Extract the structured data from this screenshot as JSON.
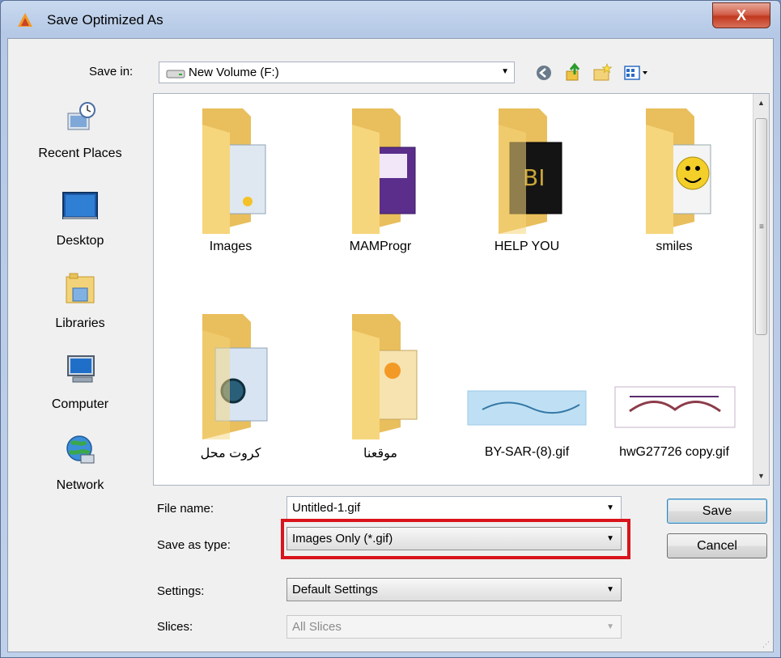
{
  "window": {
    "title": "Save Optimized As",
    "close_label": "X"
  },
  "toolbar": {
    "save_in_label": "Save in:",
    "save_in_value": "New Volume (F:)"
  },
  "places": [
    {
      "label": "Recent Places",
      "icon": "recent-places-icon"
    },
    {
      "label": "Desktop",
      "icon": "desktop-icon"
    },
    {
      "label": "Libraries",
      "icon": "libraries-icon"
    },
    {
      "label": "Computer",
      "icon": "computer-icon"
    },
    {
      "label": "Network",
      "icon": "network-icon"
    }
  ],
  "files": [
    {
      "name": "Images",
      "kind": "folder"
    },
    {
      "name": "MAMProgr",
      "kind": "folder"
    },
    {
      "name": "HELP YOU",
      "kind": "folder"
    },
    {
      "name": "smiles",
      "kind": "folder"
    },
    {
      "name": "كروت محل",
      "kind": "folder"
    },
    {
      "name": "موقعنا",
      "kind": "folder"
    },
    {
      "name": "BY-SAR-(8).gif",
      "kind": "image"
    },
    {
      "name": "hwG27726 copy.gif",
      "kind": "image"
    }
  ],
  "form": {
    "file_name_label": "File name:",
    "file_name_value": "Untitled-1.gif",
    "save_as_type_label": "Save as type:",
    "save_as_type_value": "Images Only (*.gif)",
    "settings_label": "Settings:",
    "settings_value": "Default Settings",
    "slices_label": "Slices:",
    "slices_value": "All Slices"
  },
  "buttons": {
    "save": "Save",
    "cancel": "Cancel"
  },
  "colors": {
    "highlight": "#d9141c",
    "folder": "#f3d37a",
    "client_bg": "#f0f0f0"
  }
}
